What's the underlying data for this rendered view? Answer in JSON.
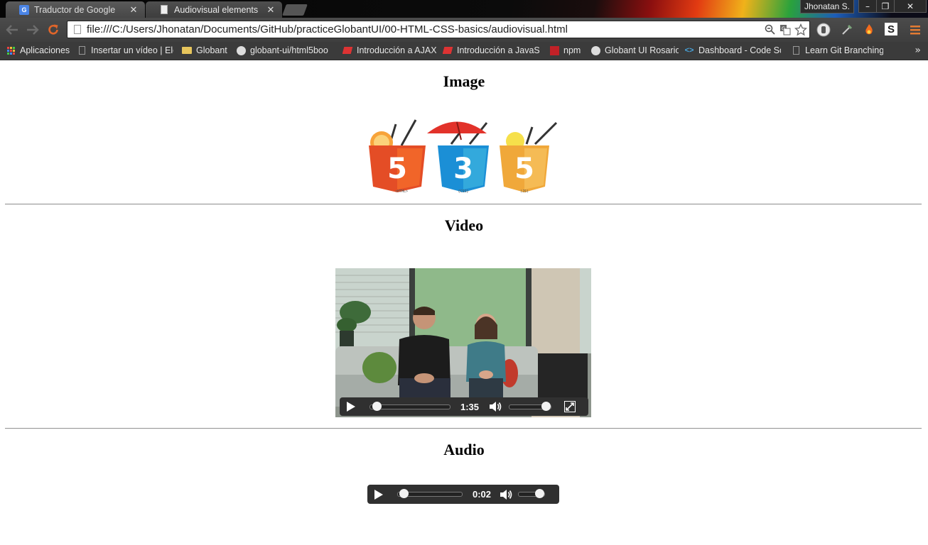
{
  "browser": {
    "tabs": [
      {
        "label": "Traductor de Google",
        "icon": "google-translate-icon",
        "active": false
      },
      {
        "label": "Audiovisual elements",
        "icon": "page-icon",
        "active": true
      }
    ],
    "user_badge": "Jhonatan S.",
    "window_controls": {
      "minimize": "–",
      "maximize": "❐",
      "close": "✕"
    },
    "address": "file:///C:/Users/Jhonatan/Documents/GitHub/practiceGlobantUI/00-HTML-CSS-basics/audiovisual.html",
    "bookmarks": [
      {
        "label": "Aplicaciones",
        "icon": "apps-grid-icon"
      },
      {
        "label": "Insertar un vídeo | Eler",
        "icon": "document-icon"
      },
      {
        "label": "Globant",
        "icon": "folder-icon"
      },
      {
        "label": "globant-ui/html5boo",
        "icon": "github-icon"
      },
      {
        "label": "Introducción a AJAX",
        "icon": "codeschool-icon"
      },
      {
        "label": "Introducción a JavaSc",
        "icon": "codeschool-icon"
      },
      {
        "label": "npm",
        "icon": "npm-icon"
      },
      {
        "label": "Globant UI Rosario",
        "icon": "github-icon"
      },
      {
        "label": "Dashboard - Code Sch",
        "icon": "code-icon"
      },
      {
        "label": "Learn Git Branching",
        "icon": "document-icon"
      }
    ],
    "bookmarks_overflow": "»"
  },
  "page": {
    "image_heading": "Image",
    "video_heading": "Video",
    "audio_heading": "Audio",
    "logo_labels": [
      "<HTML>",
      "{CSS}",
      "(JS)"
    ],
    "video": {
      "time": "1:35",
      "progress": 0.03,
      "volume": 1.0
    },
    "audio": {
      "time": "0:02",
      "progress": 0.02,
      "volume": 1.0
    }
  },
  "colors": {
    "html5": "#e44d26",
    "css3": "#1b8fd6",
    "js": "#f0a83a",
    "controls_bg": "#303030"
  }
}
